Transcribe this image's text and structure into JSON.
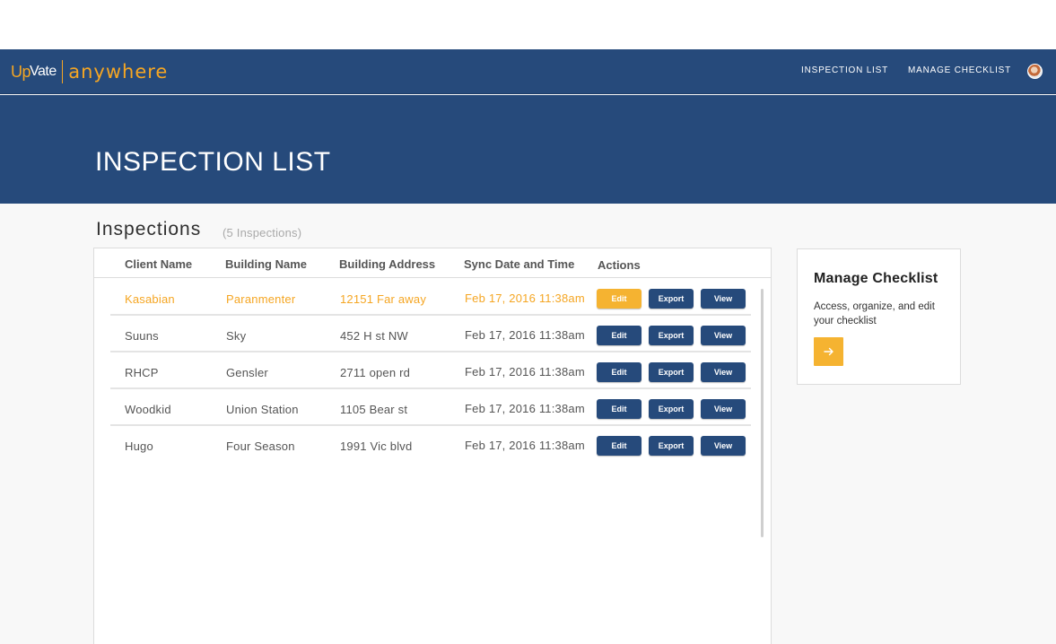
{
  "app": {
    "logo_prefix": "Up",
    "logo_main": "Vate",
    "logo_word": "anywhere"
  },
  "nav": {
    "items": [
      {
        "label": "INSPECTION LIST"
      },
      {
        "label": "MANAGE CHECKLIST"
      }
    ]
  },
  "hero": {
    "title": "INSPECTION LIST"
  },
  "section": {
    "title": "Inspections",
    "count": "(5 Inspections)"
  },
  "table": {
    "columns": [
      "Client Name",
      "Building Name",
      "Building Address",
      "Sync Date and Time",
      "Actions"
    ],
    "rows": [
      {
        "client": "Kasabian",
        "building": "Paranmenter",
        "address": "12151 Far away",
        "sync": "Feb 17, 2016 11:38am",
        "highlighted": true
      },
      {
        "client": "Suuns",
        "building": "Sky",
        "address": "452 H st NW",
        "sync": "Feb 17, 2016 11:38am",
        "highlighted": false
      },
      {
        "client": "RHCP",
        "building": "Gensler",
        "address": "2711 open rd",
        "sync": "Feb 17, 2016 11:38am",
        "highlighted": false
      },
      {
        "client": "Woodkid",
        "building": "Union Station",
        "address": "1105 Bear st",
        "sync": "Feb 17, 2016 11:38am",
        "highlighted": false
      },
      {
        "client": "Hugo",
        "building": "Four Season",
        "address": "1991 Vic blvd",
        "sync": "Feb 17, 2016 11:38am",
        "highlighted": false
      }
    ],
    "actions": {
      "edit": "Edit",
      "export": "Export",
      "view": "View"
    }
  },
  "card": {
    "title": "Manage Checklist",
    "text": "Access, organize, and edit your checklist",
    "button_icon": "arrow-right-icon"
  },
  "colors": {
    "primary": "#264a7b",
    "accent": "#f5a623"
  }
}
